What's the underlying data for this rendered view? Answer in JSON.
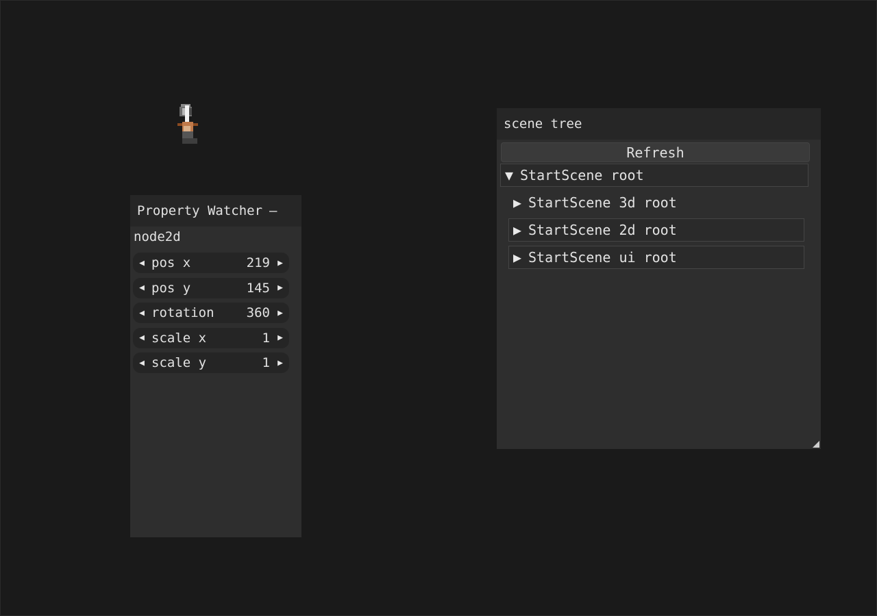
{
  "property_watcher": {
    "title": "Property Watcher",
    "collapse_glyph": "–",
    "node_label": "node2d",
    "properties": [
      {
        "label": "pos x",
        "value": "219"
      },
      {
        "label": "pos y",
        "value": "145"
      },
      {
        "label": "rotation",
        "value": "360"
      },
      {
        "label": "scale x",
        "value": "1"
      },
      {
        "label": "scale y",
        "value": "1"
      }
    ],
    "left_arrow": "◀",
    "right_arrow": "▶"
  },
  "scene_tree": {
    "title": "scene tree",
    "refresh_label": "Refresh",
    "expanded_glyph": "▼",
    "collapsed_glyph": "▶",
    "root": {
      "label": "StartScene root"
    },
    "children": [
      {
        "label": "StartScene 3d root"
      },
      {
        "label": "StartScene 2d root"
      },
      {
        "label": "StartScene ui root"
      }
    ]
  },
  "colors": {
    "background": "#1a1a1a",
    "panel": "#2e2e2e",
    "titlebar": "#262626",
    "text": "#e2e2e2"
  }
}
